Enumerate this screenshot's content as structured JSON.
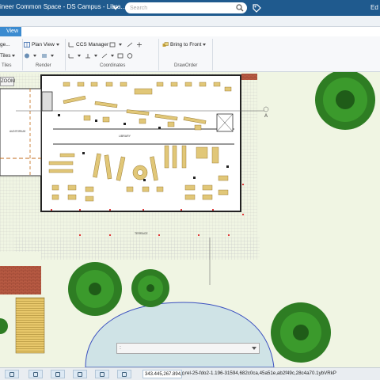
{
  "window": {
    "title": "ineer Common Space - DS Campus - Libra...",
    "user_initials": "Ed"
  },
  "search": {
    "placeholder": "Search",
    "value": ""
  },
  "ribbon": {
    "active_tab": "View",
    "rows": {
      "col1": [
        "ge...",
        "Tiles"
      ],
      "plan_view": "Plan View",
      "ccs_manager": "CCS Manager",
      "bring_to_front": "Bring to Front"
    },
    "groups": [
      "Tiles",
      "Render",
      "Coordinates",
      "DrawOrder"
    ]
  },
  "canvas": {
    "zoom_label": "ZOOM",
    "section_marker": "A",
    "room_labels": [
      "LIBRARY",
      "AUDITORIUM",
      "TERRACE"
    ]
  },
  "command_line": {
    "prompt": ":",
    "value": ""
  },
  "status": {
    "coordinates": "343.445,267.894,0",
    "id_text": "rel-25-fdo2-1.196-31594,682c0ca,45a51e,ab2f49c,28c4a70.1ybVRkP"
  },
  "colors": {
    "titlebar": "#1f5a8e",
    "accent": "#3b8bd0",
    "lawn": "#f0f5e3",
    "tree": "#2e7d23",
    "water": "#cfe3e6",
    "furniture": "#e1c778",
    "brick": "#b75a43"
  }
}
